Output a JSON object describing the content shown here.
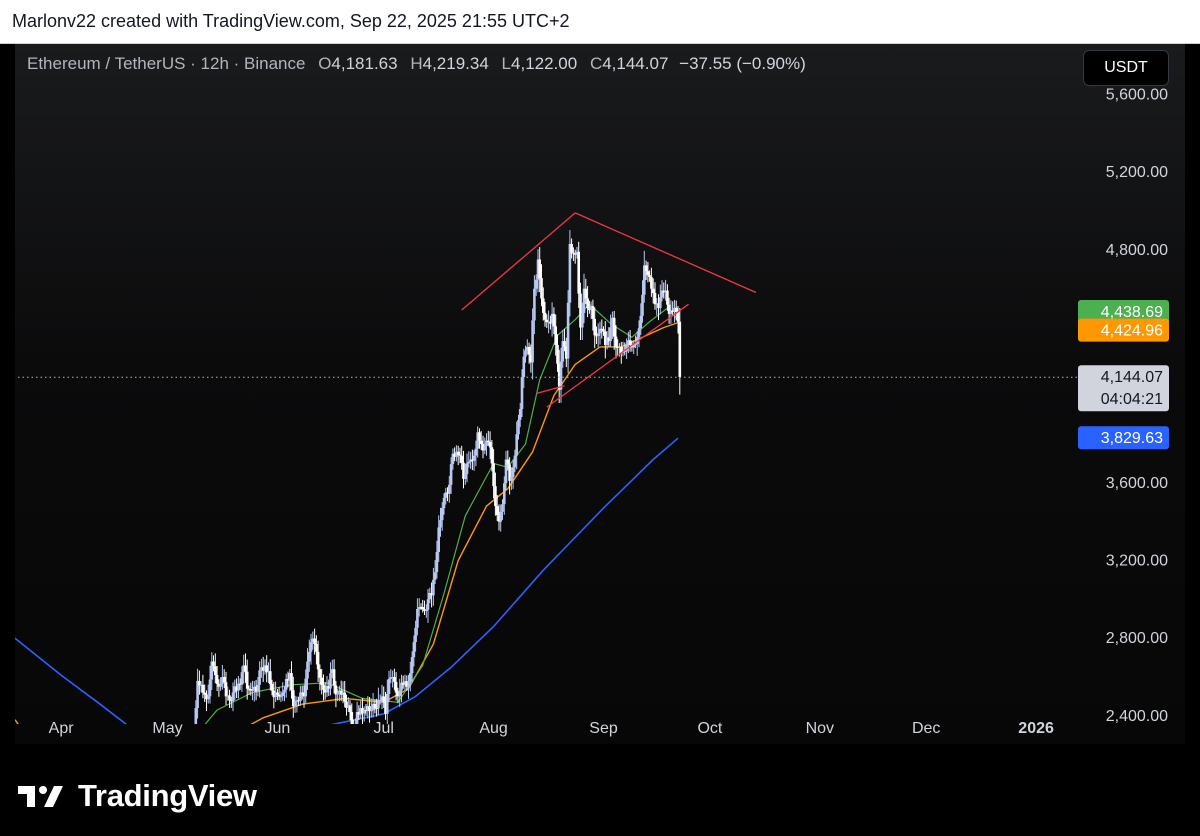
{
  "header": {
    "caption": "Marlonv22 created with TradingView.com, Sep 22, 2025 21:55 UTC+2"
  },
  "legend": {
    "symbol": "Ethereum / TetherUS · 12h · Binance",
    "open_label": "O",
    "open": "4,181.63",
    "high_label": "H",
    "high": "4,219.34",
    "low_label": "L",
    "low": "4,122.00",
    "close_label": "C",
    "close": "4,144.07",
    "change": "−37.55 (−0.90%)"
  },
  "currency_button": "USDT",
  "footer": {
    "brand": "TradingView"
  },
  "colors": {
    "up": "#b8c8f2",
    "down": "#ffffff",
    "ma_short": "#4caf50",
    "ma_mid": "#ff9800",
    "ma_long": "#2962ff",
    "pattern": "#f23645",
    "axis_text": "#d1d4dc",
    "close_line": "#b2b5be"
  },
  "chart_data": {
    "type": "candlestick",
    "symbol": "ETHUSDT",
    "timeframe": "12h",
    "x_range": [
      "2025-03-19",
      "2026-02-12"
    ],
    "ylim": [
      2255,
      5860
    ],
    "y_ticks": [
      "5,600.00",
      "5,200.00",
      "4,800.00",
      "3,600.00",
      "3,200.00",
      "2,800.00",
      "2,400.00"
    ],
    "y_tick_values": [
      5600,
      5200,
      4800,
      3600,
      3200,
      2800,
      2400
    ],
    "x_ticks": [
      {
        "label": "Apr",
        "date": "2025-04-01"
      },
      {
        "label": "May",
        "date": "2025-05-01"
      },
      {
        "label": "Jun",
        "date": "2025-06-01"
      },
      {
        "label": "Jul",
        "date": "2025-07-01"
      },
      {
        "label": "Aug",
        "date": "2025-08-01"
      },
      {
        "label": "Sep",
        "date": "2025-09-01"
      },
      {
        "label": "Oct",
        "date": "2025-10-01"
      },
      {
        "label": "Nov",
        "date": "2025-11-01"
      },
      {
        "label": "Dec",
        "date": "2025-12-01"
      },
      {
        "label": "2026",
        "date": "2026-01-01",
        "bold": true
      }
    ],
    "price_labels": [
      {
        "text": "4,438.69",
        "value": 4438.69,
        "color": "#4caf50"
      },
      {
        "text": "4,424.96",
        "value": 4424.96,
        "color": "#ff9800"
      },
      {
        "text": "4,144.07",
        "value": 4144.07,
        "color": "#d1d4dc",
        "countdown": "04:04:21"
      },
      {
        "text": "3,829.63",
        "value": 3829.63,
        "color": "#2962ff"
      }
    ],
    "close_price": 4144.07,
    "candle_daily_closes": [
      [
        "2025-05-08",
        2300
      ],
      [
        "2025-05-09",
        2580
      ],
      [
        "2025-05-10",
        2560
      ],
      [
        "2025-05-11",
        2510
      ],
      [
        "2025-05-12",
        2500
      ],
      [
        "2025-05-13",
        2680
      ],
      [
        "2025-05-14",
        2610
      ],
      [
        "2025-05-15",
        2550
      ],
      [
        "2025-05-16",
        2600
      ],
      [
        "2025-05-17",
        2500
      ],
      [
        "2025-05-18",
        2480
      ],
      [
        "2025-05-19",
        2520
      ],
      [
        "2025-05-20",
        2530
      ],
      [
        "2025-05-21",
        2560
      ],
      [
        "2025-05-22",
        2660
      ],
      [
        "2025-05-23",
        2540
      ],
      [
        "2025-05-24",
        2530
      ],
      [
        "2025-05-25",
        2550
      ],
      [
        "2025-05-26",
        2560
      ],
      [
        "2025-05-27",
        2650
      ],
      [
        "2025-05-28",
        2660
      ],
      [
        "2025-05-29",
        2630
      ],
      [
        "2025-05-30",
        2530
      ],
      [
        "2025-05-31",
        2520
      ],
      [
        "2025-06-01",
        2500
      ],
      [
        "2025-06-02",
        2520
      ],
      [
        "2025-06-03",
        2590
      ],
      [
        "2025-06-04",
        2620
      ],
      [
        "2025-06-05",
        2450
      ],
      [
        "2025-06-06",
        2480
      ],
      [
        "2025-06-07",
        2520
      ],
      [
        "2025-06-08",
        2500
      ],
      [
        "2025-06-09",
        2680
      ],
      [
        "2025-06-10",
        2780
      ],
      [
        "2025-06-11",
        2770
      ],
      [
        "2025-06-12",
        2640
      ],
      [
        "2025-06-13",
        2560
      ],
      [
        "2025-06-14",
        2520
      ],
      [
        "2025-06-15",
        2540
      ],
      [
        "2025-06-16",
        2640
      ],
      [
        "2025-06-17",
        2510
      ],
      [
        "2025-06-18",
        2530
      ],
      [
        "2025-06-19",
        2520
      ],
      [
        "2025-06-20",
        2440
      ],
      [
        "2025-06-21",
        2420
      ],
      [
        "2025-06-22",
        2300
      ],
      [
        "2025-06-23",
        2420
      ],
      [
        "2025-06-24",
        2440
      ],
      [
        "2025-06-25",
        2430
      ],
      [
        "2025-06-26",
        2450
      ],
      [
        "2025-06-27",
        2430
      ],
      [
        "2025-06-28",
        2440
      ],
      [
        "2025-06-29",
        2480
      ],
      [
        "2025-06-30",
        2500
      ],
      [
        "2025-07-01",
        2410
      ],
      [
        "2025-07-02",
        2590
      ],
      [
        "2025-07-03",
        2600
      ],
      [
        "2025-07-04",
        2520
      ],
      [
        "2025-07-05",
        2530
      ],
      [
        "2025-07-06",
        2560
      ],
      [
        "2025-07-07",
        2550
      ],
      [
        "2025-07-08",
        2620
      ],
      [
        "2025-07-09",
        2780
      ],
      [
        "2025-07-10",
        2950
      ],
      [
        "2025-07-11",
        2960
      ],
      [
        "2025-07-12",
        2940
      ],
      [
        "2025-07-13",
        3000
      ],
      [
        "2025-07-14",
        3020
      ],
      [
        "2025-07-15",
        3140
      ],
      [
        "2025-07-16",
        3370
      ],
      [
        "2025-07-17",
        3470
      ],
      [
        "2025-07-18",
        3550
      ],
      [
        "2025-07-19",
        3590
      ],
      [
        "2025-07-20",
        3750
      ],
      [
        "2025-07-21",
        3760
      ],
      [
        "2025-07-22",
        3740
      ],
      [
        "2025-07-23",
        3620
      ],
      [
        "2025-07-24",
        3700
      ],
      [
        "2025-07-25",
        3720
      ],
      [
        "2025-07-26",
        3740
      ],
      [
        "2025-07-27",
        3860
      ],
      [
        "2025-07-28",
        3800
      ],
      [
        "2025-07-29",
        3790
      ],
      [
        "2025-07-30",
        3810
      ],
      [
        "2025-07-31",
        3700
      ],
      [
        "2025-08-01",
        3480
      ],
      [
        "2025-08-02",
        3400
      ],
      [
        "2025-08-03",
        3490
      ],
      [
        "2025-08-04",
        3720
      ],
      [
        "2025-08-05",
        3610
      ],
      [
        "2025-08-06",
        3680
      ],
      [
        "2025-08-07",
        3850
      ],
      [
        "2025-08-08",
        3980
      ],
      [
        "2025-08-09",
        4250
      ],
      [
        "2025-08-10",
        4300
      ],
      [
        "2025-08-11",
        4220
      ],
      [
        "2025-08-12",
        4600
      ],
      [
        "2025-08-13",
        4750
      ],
      [
        "2025-08-14",
        4550
      ],
      [
        "2025-08-15",
        4440
      ],
      [
        "2025-08-16",
        4430
      ],
      [
        "2025-08-17",
        4470
      ],
      [
        "2025-08-18",
        4310
      ],
      [
        "2025-08-19",
        4080
      ],
      [
        "2025-08-20",
        4330
      ],
      [
        "2025-08-21",
        4240
      ],
      [
        "2025-08-22",
        4830
      ],
      [
        "2025-08-23",
        4780
      ],
      [
        "2025-08-24",
        4790
      ],
      [
        "2025-08-25",
        4400
      ],
      [
        "2025-08-26",
        4600
      ],
      [
        "2025-08-27",
        4500
      ],
      [
        "2025-08-28",
        4510
      ],
      [
        "2025-08-29",
        4360
      ],
      [
        "2025-08-30",
        4370
      ],
      [
        "2025-08-31",
        4390
      ],
      [
        "2025-09-01",
        4310
      ],
      [
        "2025-09-02",
        4330
      ],
      [
        "2025-09-03",
        4450
      ],
      [
        "2025-09-04",
        4300
      ],
      [
        "2025-09-05",
        4300
      ],
      [
        "2025-09-06",
        4280
      ],
      [
        "2025-09-07",
        4310
      ],
      [
        "2025-09-08",
        4310
      ],
      [
        "2025-09-09",
        4310
      ],
      [
        "2025-09-10",
        4350
      ],
      [
        "2025-09-11",
        4460
      ],
      [
        "2025-09-12",
        4720
      ],
      [
        "2025-09-13",
        4670
      ],
      [
        "2025-09-14",
        4600
      ],
      [
        "2025-09-15",
        4520
      ],
      [
        "2025-09-16",
        4500
      ],
      [
        "2025-09-17",
        4590
      ],
      [
        "2025-09-18",
        4590
      ],
      [
        "2025-09-19",
        4470
      ],
      [
        "2025-09-20",
        4480
      ],
      [
        "2025-09-21",
        4480
      ],
      [
        "2025-09-22",
        4144.07
      ]
    ],
    "ma_short_points": [
      [
        "2025-05-09",
        2300
      ],
      [
        "2025-05-15",
        2430
      ],
      [
        "2025-05-25",
        2520
      ],
      [
        "2025-06-05",
        2560
      ],
      [
        "2025-06-15",
        2570
      ],
      [
        "2025-06-25",
        2490
      ],
      [
        "2025-07-05",
        2470
      ],
      [
        "2025-07-12",
        2660
      ],
      [
        "2025-07-18",
        3030
      ],
      [
        "2025-07-24",
        3430
      ],
      [
        "2025-08-01",
        3700
      ],
      [
        "2025-08-05",
        3680
      ],
      [
        "2025-08-10",
        3800
      ],
      [
        "2025-08-14",
        4130
      ],
      [
        "2025-08-19",
        4360
      ],
      [
        "2025-08-24",
        4440
      ],
      [
        "2025-08-28",
        4520
      ],
      [
        "2025-09-03",
        4420
      ],
      [
        "2025-09-09",
        4350
      ],
      [
        "2025-09-14",
        4430
      ],
      [
        "2025-09-19",
        4500
      ],
      [
        "2025-09-22",
        4438.69
      ]
    ],
    "ma_mid_points": [
      [
        "2025-05-19",
        2300
      ],
      [
        "2025-05-28",
        2390
      ],
      [
        "2025-06-08",
        2460
      ],
      [
        "2025-06-20",
        2490
      ],
      [
        "2025-07-01",
        2470
      ],
      [
        "2025-07-08",
        2540
      ],
      [
        "2025-07-15",
        2770
      ],
      [
        "2025-07-22",
        3200
      ],
      [
        "2025-07-30",
        3480
      ],
      [
        "2025-08-05",
        3570
      ],
      [
        "2025-08-12",
        3760
      ],
      [
        "2025-08-18",
        4050
      ],
      [
        "2025-08-24",
        4210
      ],
      [
        "2025-08-31",
        4300
      ],
      [
        "2025-09-06",
        4300
      ],
      [
        "2025-09-12",
        4350
      ],
      [
        "2025-09-18",
        4400
      ],
      [
        "2025-09-22",
        4424.96
      ]
    ],
    "ma_long_points": [
      [
        "2025-03-19",
        2800
      ],
      [
        "2025-04-01",
        2610
      ],
      [
        "2025-04-12",
        2460
      ],
      [
        "2025-04-22",
        2320
      ],
      [
        "2025-04-25",
        2270
      ],
      [
        "2025-06-15",
        2350
      ],
      [
        "2025-07-01",
        2410
      ],
      [
        "2025-07-10",
        2500
      ],
      [
        "2025-07-20",
        2650
      ],
      [
        "2025-08-01",
        2860
      ],
      [
        "2025-08-15",
        3150
      ],
      [
        "2025-09-01",
        3470
      ],
      [
        "2025-09-15",
        3720
      ],
      [
        "2025-09-22",
        3829.63
      ]
    ],
    "ma_mid_left_points": [
      [
        "2025-03-19",
        2380
      ],
      [
        "2025-03-22",
        2300
      ]
    ],
    "pattern_lines": [
      {
        "from": [
          "2025-07-23",
          4490
        ],
        "to": [
          "2025-08-24",
          4990
        ]
      },
      {
        "from": [
          "2025-08-24",
          4990
        ],
        "to": [
          "2025-10-14",
          4580
        ]
      },
      {
        "from": [
          "2025-08-16",
          3990
        ],
        "to": [
          "2025-09-25",
          4520
        ]
      },
      {
        "from": [
          "2025-08-13",
          4060
        ],
        "to": [
          "2025-08-21",
          4100
        ]
      }
    ]
  }
}
